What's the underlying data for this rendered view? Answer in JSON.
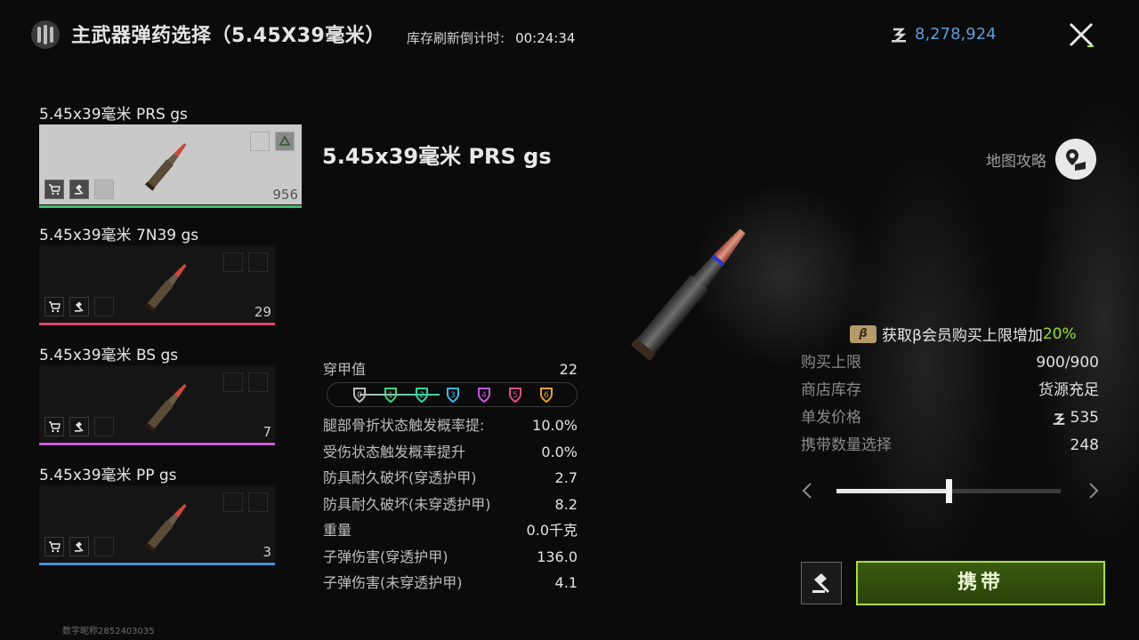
{
  "header": {
    "title": "主武器弹药选择（5.45X39毫米）",
    "refresh_label": "库存刷新倒计时:",
    "refresh_time": "00:24:34",
    "currency_amount": "8,278,924"
  },
  "ammo_list": [
    {
      "name": "5.45x39毫米  PRS gs",
      "count": "956",
      "bar_color": "#3fbf6f",
      "selected": true
    },
    {
      "name": "5.45x39毫米  7N39 gs",
      "count": "29",
      "bar_color": "#e0436a",
      "selected": false
    },
    {
      "name": "5.45x39毫米 BS gs",
      "count": "7",
      "bar_color": "#c95ad8",
      "selected": false
    },
    {
      "name": "5.45x39毫米  PP gs",
      "count": "3",
      "bar_color": "#4a8fd8",
      "selected": false
    }
  ],
  "detail": {
    "name": "5.45x39毫米  PRS gs",
    "penetration_label": "穿甲值",
    "penetration_value": "22",
    "armor_tiers": [
      {
        "label": "0",
        "color": "#bdbdbd"
      },
      {
        "label": "1",
        "color": "#3fd17a"
      },
      {
        "label": "2",
        "color": "#2fd6a0"
      },
      {
        "label": "3",
        "color": "#3ab8e6"
      },
      {
        "label": "4",
        "color": "#c15ae0"
      },
      {
        "label": "5",
        "color": "#e04a8a"
      },
      {
        "label": "6",
        "color": "#e0a030"
      }
    ],
    "stats": [
      {
        "label": "腿部骨折状态触发概率提:",
        "value": "10.0%"
      },
      {
        "label": "受伤状态触发概率提升",
        "value": "0.0%"
      },
      {
        "label": "防具耐久破坏(穿透护甲)",
        "value": "2.7"
      },
      {
        "label": "防具耐久破坏(未穿透护甲)",
        "value": "8.2"
      },
      {
        "label": "重量",
        "value": "0.0千克"
      },
      {
        "label": "子弹伤害(穿透护甲)",
        "value": "136.0"
      },
      {
        "label": "子弹伤害(未穿透护甲)",
        "value": "4.1"
      }
    ]
  },
  "map_guide_label": "地图攻略",
  "vip": {
    "badge": "β",
    "text": "获取β会员购买上限增加",
    "percent": "20%"
  },
  "purchase": {
    "limit_label": "购买上限",
    "limit_value": "900/900",
    "stock_label": "商店库存",
    "stock_value": "货源充足",
    "price_label": "单发价格",
    "price_value": "535",
    "carry_qty_label": "携带数量选择",
    "carry_qty_value": "248",
    "slider_fraction": 0.5
  },
  "carry_button_label": "携带",
  "footer_id": "数字昵称2852403035",
  "colors": {
    "accent_green": "#a8e034",
    "currency_blue": "#5e9ad6",
    "vip_percent": "#9be02b"
  }
}
